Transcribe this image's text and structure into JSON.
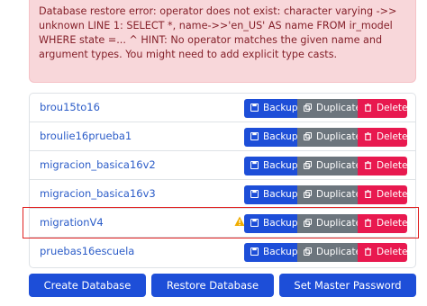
{
  "alert": {
    "message": "Database restore error: operator does not exist: character varying ->> unknown LINE 1: SELECT *, name->>'en_US' AS name FROM ir_model WHERE state =... ^ HINT: No operator matches the given name and argument types. You might need to add explicit type casts."
  },
  "databases": [
    {
      "name": "brou15to16",
      "warning": false
    },
    {
      "name": "broulie16prueba1",
      "warning": false
    },
    {
      "name": "migracion_basica16v2",
      "warning": false
    },
    {
      "name": "migracion_basica16v3",
      "warning": false
    },
    {
      "name": "migrationV4",
      "warning": true
    },
    {
      "name": "pruebas16escuela",
      "warning": false
    }
  ],
  "row_actions": {
    "backup": "Backup",
    "duplicate": "Duplicate",
    "delete": "Delete"
  },
  "footer": {
    "create": "Create Database",
    "restore": "Restore Database",
    "master": "Set Master Password"
  },
  "colors": {
    "primary": "#1d4ed8",
    "secondary": "#6c757d",
    "danger": "#e8194f",
    "alert_bg": "#f8d7da",
    "alert_text": "#842029",
    "highlight": "#e02020",
    "warning": "#f0ad00"
  }
}
